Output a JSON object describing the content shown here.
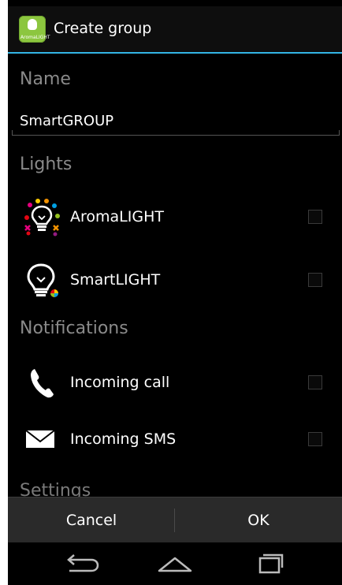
{
  "title_bar": {
    "title": "Create group",
    "app_icon_text": "AromaLIGHT"
  },
  "name_section": {
    "header": "Name",
    "value": "SmartGROUP"
  },
  "lights_section": {
    "header": "Lights",
    "items": [
      {
        "label": "AromaLIGHT",
        "icon": "aroma-bulb-icon",
        "checked": false
      },
      {
        "label": "SmartLIGHT",
        "icon": "smart-bulb-icon",
        "checked": false
      }
    ]
  },
  "notifications_section": {
    "header": "Notifications",
    "items": [
      {
        "label": "Incoming call",
        "icon": "phone-icon",
        "checked": false
      },
      {
        "label": "Incoming SMS",
        "icon": "envelope-icon",
        "checked": false
      }
    ]
  },
  "settings_section": {
    "header": "Settings"
  },
  "buttons": {
    "cancel": "Cancel",
    "ok": "OK"
  },
  "colors": {
    "accent": "#33b5e5",
    "app_icon": "#8cc63f",
    "background": "#000000"
  }
}
